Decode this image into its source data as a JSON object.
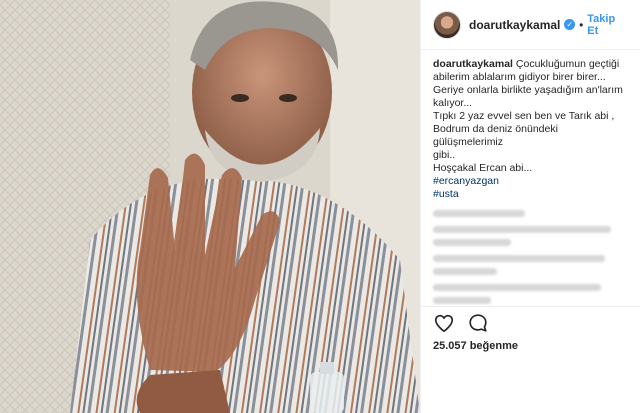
{
  "post": {
    "username": "doarutkaykamal",
    "verified_badge": "✓",
    "separator": "•",
    "follow_label": "Takip Et",
    "caption_username": "doarutkaykamal",
    "caption_lines": [
      "Çocukluğumun geçtiği",
      "abilerim ablalarım gidiyor birer birer...",
      "Geriye onlarla birlikte yaşadığım an'larım",
      "kalıyor...",
      "Tıpkı 2 yaz evvel sen ben ve Tarık abi ,",
      "Bodrum da deniz önündeki gülüşmelerimiz",
      "gibi..",
      "Hoşçakal Ercan abi..."
    ],
    "hashtags": [
      "#ercanyazgan",
      "#usta"
    ],
    "likes": "25.057 beğenme"
  },
  "icons": {
    "like": "heart-icon",
    "comment": "comment-icon",
    "verified": "verified-badge-icon",
    "avatar": "avatar"
  },
  "colors": {
    "link_blue": "#3897f0",
    "hashtag": "#003569",
    "text": "#262626"
  }
}
